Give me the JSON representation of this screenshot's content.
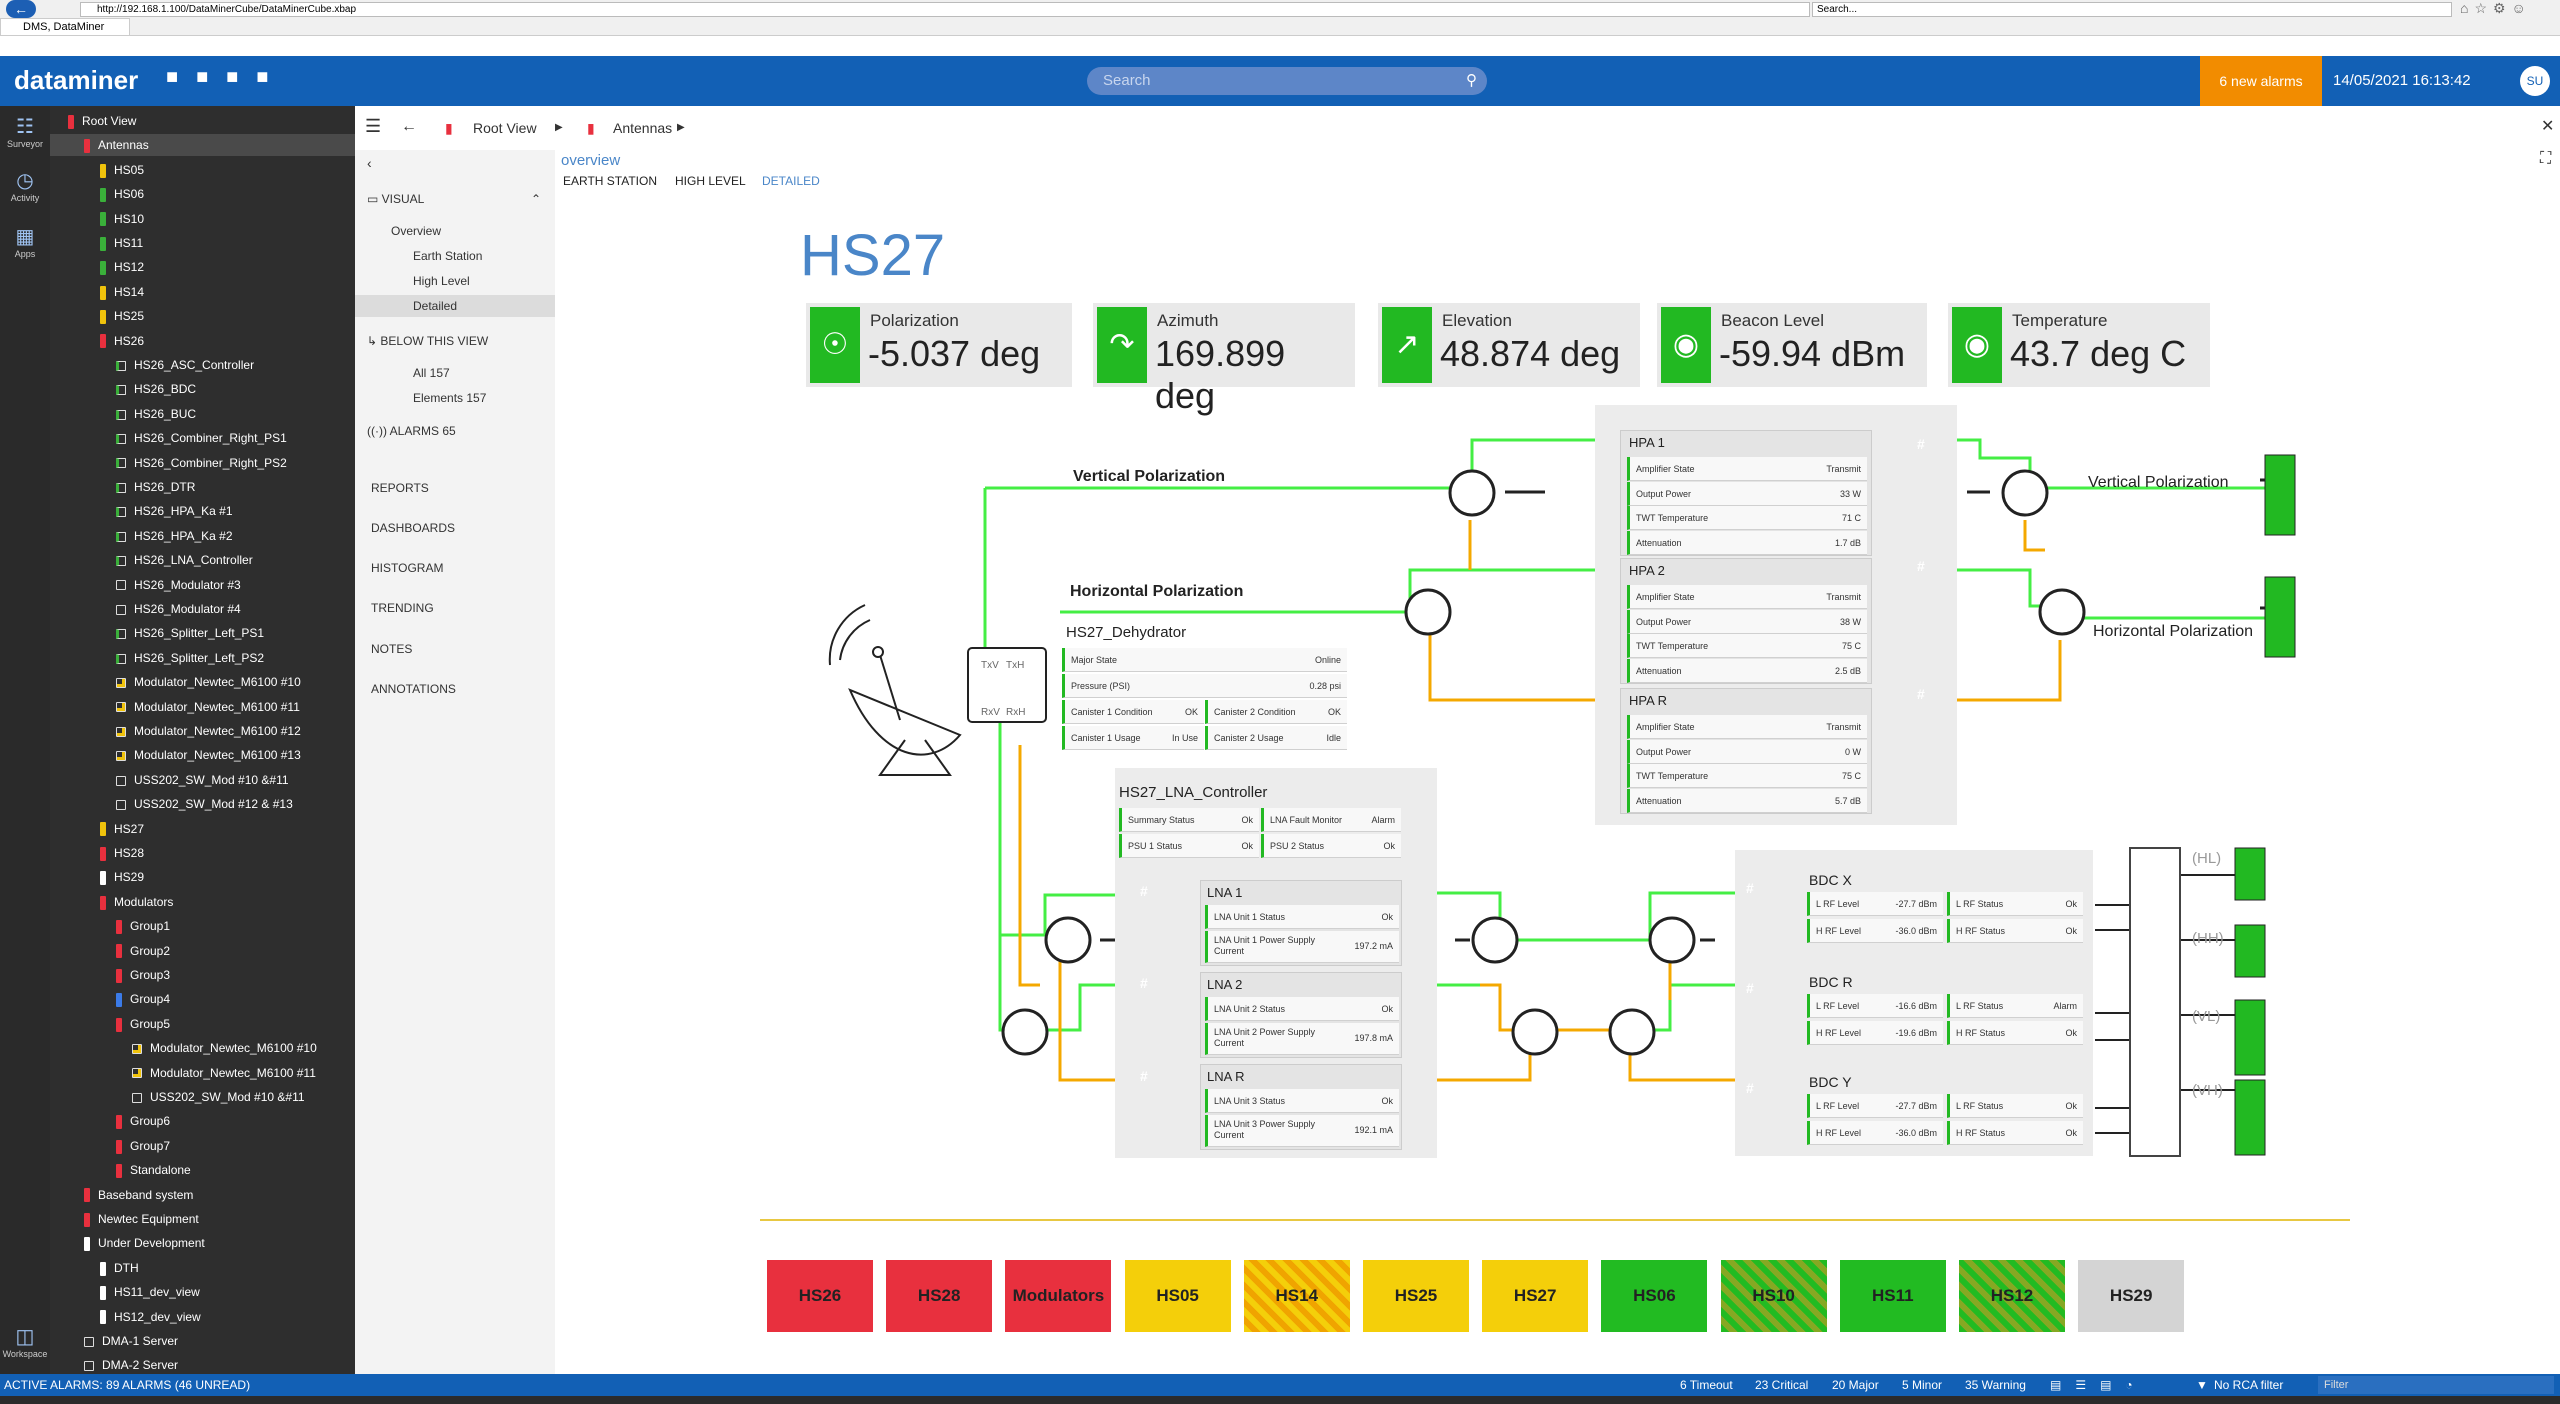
{
  "browser": {
    "url": "http://192.168.1.100/DataMinerCube/DataMinerCube.xbap",
    "search_placeholder": "Search...",
    "tab_title": "DMS, DataMiner"
  },
  "header": {
    "logo": "dataminer",
    "search_placeholder": "Search",
    "alarms": "6 new alarms",
    "datetime": "14/05/2021 16:13:42",
    "user": "SU"
  },
  "rail": {
    "surveyor": "Surveyor",
    "activity": "Activity",
    "apps": "Apps",
    "workspace": "Workspace"
  },
  "tree": [
    {
      "label": "Root View",
      "indent": 0,
      "mark": "red"
    },
    {
      "label": "Antennas",
      "indent": 1,
      "mark": "red",
      "selected": true
    },
    {
      "label": "HS05",
      "indent": 2,
      "mark": "yel"
    },
    {
      "label": "HS06",
      "indent": 2,
      "mark": "grn"
    },
    {
      "label": "HS10",
      "indent": 2,
      "mark": "grn"
    },
    {
      "label": "HS11",
      "indent": 2,
      "mark": "grn"
    },
    {
      "label": "HS12",
      "indent": 2,
      "mark": "grn"
    },
    {
      "label": "HS14",
      "indent": 2,
      "mark": "yel"
    },
    {
      "label": "HS25",
      "indent": 2,
      "mark": "yel"
    },
    {
      "label": "HS26",
      "indent": 2,
      "mark": "red"
    },
    {
      "label": "HS26_ASC_Controller",
      "indent": 3,
      "mark": "boxg"
    },
    {
      "label": "HS26_BDC",
      "indent": 3,
      "mark": "boxg"
    },
    {
      "label": "HS26_BUC",
      "indent": 3,
      "mark": "boxg"
    },
    {
      "label": "HS26_Combiner_Right_PS1",
      "indent": 3,
      "mark": "boxg"
    },
    {
      "label": "HS26_Combiner_Right_PS2",
      "indent": 3,
      "mark": "boxg"
    },
    {
      "label": "HS26_DTR",
      "indent": 3,
      "mark": "boxg"
    },
    {
      "label": "HS26_HPA_Ka #1",
      "indent": 3,
      "mark": "boxg"
    },
    {
      "label": "HS26_HPA_Ka #2",
      "indent": 3,
      "mark": "boxg"
    },
    {
      "label": "HS26_LNA_Controller",
      "indent": 3,
      "mark": "boxg"
    },
    {
      "label": "HS26_Modulator #3",
      "indent": 3,
      "mark": "box"
    },
    {
      "label": "HS26_Modulator #4",
      "indent": 3,
      "mark": "box"
    },
    {
      "label": "HS26_Splitter_Left_PS1",
      "indent": 3,
      "mark": "boxg"
    },
    {
      "label": "HS26_Splitter_Left_PS2",
      "indent": 3,
      "mark": "boxg"
    },
    {
      "label": "Modulator_Newtec_M6100 #10",
      "indent": 3,
      "mark": "boxy"
    },
    {
      "label": "Modulator_Newtec_M6100 #11",
      "indent": 3,
      "mark": "boxy"
    },
    {
      "label": "Modulator_Newtec_M6100 #12",
      "indent": 3,
      "mark": "boxy"
    },
    {
      "label": "Modulator_Newtec_M6100 #13",
      "indent": 3,
      "mark": "boxy"
    },
    {
      "label": "USS202_SW_Mod #10 &#11",
      "indent": 3,
      "mark": "box"
    },
    {
      "label": "USS202_SW_Mod #12 & #13",
      "indent": 3,
      "mark": "box"
    },
    {
      "label": "HS27",
      "indent": 2,
      "mark": "yel"
    },
    {
      "label": "HS28",
      "indent": 2,
      "mark": "red"
    },
    {
      "label": "HS29",
      "indent": 2,
      "mark": "wht"
    },
    {
      "label": "Modulators",
      "indent": 2,
      "mark": "red"
    },
    {
      "label": "Group1",
      "indent": 3,
      "mark": "red"
    },
    {
      "label": "Group2",
      "indent": 3,
      "mark": "red"
    },
    {
      "label": "Group3",
      "indent": 3,
      "mark": "red"
    },
    {
      "label": "Group4",
      "indent": 3,
      "mark": "blu"
    },
    {
      "label": "Group5",
      "indent": 3,
      "mark": "red"
    },
    {
      "label": "Modulator_Newtec_M6100 #10",
      "indent": 4,
      "mark": "boxy"
    },
    {
      "label": "Modulator_Newtec_M6100 #11",
      "indent": 4,
      "mark": "boxy"
    },
    {
      "label": "USS202_SW_Mod #10 &#11",
      "indent": 4,
      "mark": "box"
    },
    {
      "label": "Group6",
      "indent": 3,
      "mark": "red"
    },
    {
      "label": "Group7",
      "indent": 3,
      "mark": "red"
    },
    {
      "label": "Standalone",
      "indent": 3,
      "mark": "red"
    },
    {
      "label": "Baseband system",
      "indent": 1,
      "mark": "red"
    },
    {
      "label": "Newtec Equipment",
      "indent": 1,
      "mark": "red"
    },
    {
      "label": "Under Development",
      "indent": 1,
      "mark": "wht"
    },
    {
      "label": "DTH",
      "indent": 2,
      "mark": "wht"
    },
    {
      "label": "HS11_dev_view",
      "indent": 2,
      "mark": "wht"
    },
    {
      "label": "HS12_dev_view",
      "indent": 2,
      "mark": "wht"
    },
    {
      "label": "DMA-1 Server",
      "indent": 1,
      "mark": "box"
    },
    {
      "label": "DMA-2 Server",
      "indent": 1,
      "mark": "box"
    }
  ],
  "breadcrumb": {
    "root": "Root View",
    "current": "Antennas"
  },
  "leftnav": {
    "visual": "VISUAL",
    "overview": "Overview",
    "earth_station": "Earth Station",
    "high_level": "High Level",
    "detailed": "Detailed",
    "below": "BELOW THIS VIEW",
    "all": "All 157",
    "elements": "Elements 157",
    "alarms": "ALARMS 65",
    "reports": "REPORTS",
    "dashboards": "DASHBOARDS",
    "histogram": "HISTOGRAM",
    "trending": "TRENDING",
    "notes": "NOTES",
    "annotations": "ANNOTATIONS"
  },
  "tabs": {
    "overview": "overview",
    "earth": "EARTH STATION",
    "high": "HIGH LEVEL",
    "detailed": "DETAILED"
  },
  "title": "HS27",
  "kpis": [
    {
      "label": "Polarization",
      "value": "-5.037 deg",
      "icon": "dish-icon"
    },
    {
      "label": "Azimuth",
      "value": "169.899 deg",
      "icon": "azimuth-icon"
    },
    {
      "label": "Elevation",
      "value": "48.874 deg",
      "icon": "elevation-icon"
    },
    {
      "label": "Beacon Level",
      "value": "-59.94 dBm",
      "icon": "beacon-icon"
    },
    {
      "label": "Temperature",
      "value": "43.7 deg C",
      "icon": "temperature-icon"
    }
  ],
  "diagram": {
    "vpol": "Vertical Polarization",
    "hpol": "Horizontal Polarization",
    "vpol_r": "Vertical Polarization",
    "hpol_r": "Horizontal Polarization",
    "dehy": {
      "title": "HS27_Dehydrator",
      "major_k": "Major State",
      "major_v": "Online",
      "psi_k": "Pressure (PSI)",
      "psi_v": "0.28 psi",
      "c1_k": "Canister 1 Condition",
      "c1_v": "OK",
      "c2_k": "Canister 2 Condition",
      "c2_v": "OK",
      "u1_k": "Canister 1 Usage",
      "u1_v": "In Use",
      "u2_k": "Canister 2 Usage",
      "u2_v": "Idle"
    },
    "ports": {
      "txv": "TxV",
      "txh": "TxH",
      "rxv": "RxV",
      "rxh": "RxH"
    },
    "hpa": [
      {
        "name": "HPA 1",
        "rows": [
          [
            "Amplifier State",
            "Transmit"
          ],
          [
            "Output Power",
            "33 W"
          ],
          [
            "TWT Temperature",
            "71 C"
          ],
          [
            "Attenuation",
            "1.7 dB"
          ]
        ]
      },
      {
        "name": "HPA 2",
        "rows": [
          [
            "Amplifier State",
            "Transmit"
          ],
          [
            "Output Power",
            "38 W"
          ],
          [
            "TWT Temperature",
            "75 C"
          ],
          [
            "Attenuation",
            "2.5 dB"
          ]
        ]
      },
      {
        "name": "HPA R",
        "rows": [
          [
            "Amplifier State",
            "Transmit"
          ],
          [
            "Output Power",
            "0 W"
          ],
          [
            "TWT Temperature",
            "75 C"
          ],
          [
            "Attenuation",
            "5.7 dB"
          ]
        ]
      }
    ],
    "lnactl": {
      "title": "HS27_LNA_Controller",
      "s_k": "Summary Status",
      "s_v": "Ok",
      "f_k": "LNA Fault Monitor",
      "f_v": "Alarm",
      "p1_k": "PSU 1 Status",
      "p1_v": "Ok",
      "p2_k": "PSU 2 Status",
      "p2_v": "Ok"
    },
    "lna": [
      {
        "name": "LNA 1",
        "r1k": "LNA Unit 1 Status",
        "r1v": "Ok",
        "r2k": "LNA Unit 1 Power Supply Current",
        "r2v": "197.2 mA"
      },
      {
        "name": "LNA 2",
        "r1k": "LNA Unit 2 Status",
        "r1v": "Ok",
        "r2k": "LNA Unit 2 Power Supply Current",
        "r2v": "197.8 mA"
      },
      {
        "name": "LNA R",
        "r1k": "LNA Unit 3 Status",
        "r1v": "Ok",
        "r2k": "LNA Unit 3 Power Supply Current",
        "r2v": "192.1 mA"
      }
    ],
    "bdc": [
      {
        "name": "BDC X",
        "lrf": "-27.7 dBm",
        "hrf": "-36.0 dBm",
        "ls": "Ok",
        "hs": "Ok"
      },
      {
        "name": "BDC R",
        "lrf": "-16.6 dBm",
        "hrf": "-19.6 dBm",
        "ls": "Alarm",
        "hs": "Ok"
      },
      {
        "name": "BDC Y",
        "lrf": "-27.7 dBm",
        "hrf": "-36.0 dBm",
        "ls": "Ok",
        "hs": "Ok"
      }
    ],
    "bdc_keys": {
      "lrf": "L RF Level",
      "hrf": "H RF Level",
      "ls": "L RF Status",
      "hs": "H RF Status"
    },
    "outs": [
      "(HL)",
      "(HH)",
      "(VL)",
      "(VH)"
    ],
    "amp_mark": "#"
  },
  "hs_buttons": [
    {
      "label": "HS26",
      "style": "hs-red"
    },
    {
      "label": "HS28",
      "style": "hs-red"
    },
    {
      "label": "Modulators",
      "style": "hs-red"
    },
    {
      "label": "HS05",
      "style": "hs-yel"
    },
    {
      "label": "HS14",
      "style": "hs-yh"
    },
    {
      "label": "HS25",
      "style": "hs-yel"
    },
    {
      "label": "HS27",
      "style": "hs-yel"
    },
    {
      "label": "HS06",
      "style": "hs-grn"
    },
    {
      "label": "HS10",
      "style": "hs-gh"
    },
    {
      "label": "HS11",
      "style": "hs-grn"
    },
    {
      "label": "HS12",
      "style": "hs-gh"
    },
    {
      "label": "HS29",
      "style": "hs-gry"
    }
  ],
  "status": {
    "active": "ACTIVE ALARMS: 89 ALARMS (46 UNREAD)",
    "timeout": "6 Timeout",
    "critical": "23 Critical",
    "major": "20 Major",
    "minor": "5 Minor",
    "warning": "35 Warning",
    "rca": "No RCA filter",
    "filter": "Filter"
  },
  "colors": {
    "accent": "#1260b5",
    "green": "#22b922",
    "orange": "#f4a800",
    "alarm": "#e8303e"
  }
}
